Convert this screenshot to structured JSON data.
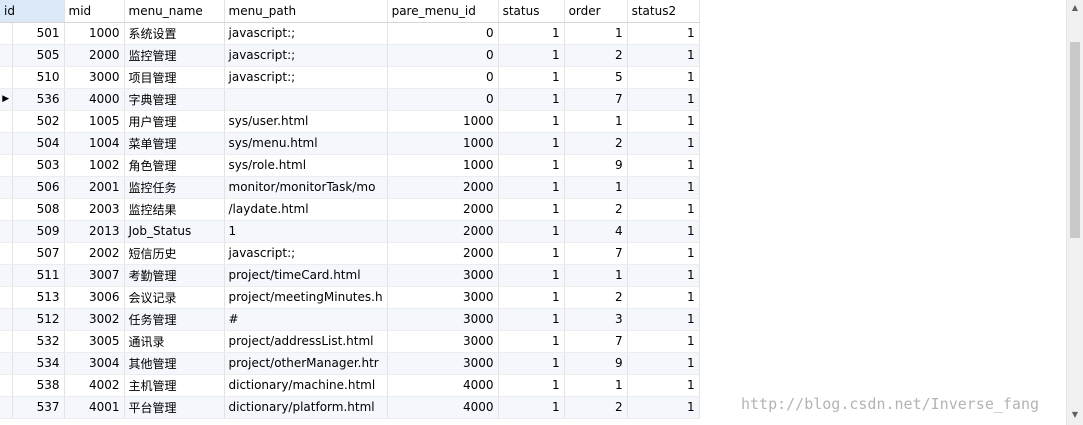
{
  "columns": [
    "id",
    "mid",
    "menu_name",
    "menu_path",
    "pare_menu_id",
    "status",
    "order",
    "status2"
  ],
  "current_row_marker_icon": "triangle-right-icon",
  "rows": [
    {
      "id": "501",
      "mid": "1000",
      "menu_name": "系统设置",
      "menu_path": "javascript:;",
      "pare_menu_id": "0",
      "status": "1",
      "order": "1",
      "status2": "1"
    },
    {
      "id": "505",
      "mid": "2000",
      "menu_name": "监控管理",
      "menu_path": "javascript:;",
      "pare_menu_id": "0",
      "status": "1",
      "order": "2",
      "status2": "1"
    },
    {
      "id": "510",
      "mid": "3000",
      "menu_name": "项目管理",
      "menu_path": "javascript:;",
      "pare_menu_id": "0",
      "status": "1",
      "order": "5",
      "status2": "1"
    },
    {
      "id": "536",
      "mid": "4000",
      "menu_name": "字典管理",
      "menu_path": "",
      "pare_menu_id": "0",
      "status": "1",
      "order": "7",
      "status2": "1"
    },
    {
      "id": "502",
      "mid": "1005",
      "menu_name": "用户管理",
      "menu_path": "sys/user.html",
      "pare_menu_id": "1000",
      "status": "1",
      "order": "1",
      "status2": "1"
    },
    {
      "id": "504",
      "mid": "1004",
      "menu_name": "菜单管理",
      "menu_path": "sys/menu.html",
      "pare_menu_id": "1000",
      "status": "1",
      "order": "2",
      "status2": "1"
    },
    {
      "id": "503",
      "mid": "1002",
      "menu_name": "角色管理",
      "menu_path": "sys/role.html",
      "pare_menu_id": "1000",
      "status": "1",
      "order": "9",
      "status2": "1"
    },
    {
      "id": "506",
      "mid": "2001",
      "menu_name": "监控任务",
      "menu_path": "monitor/monitorTask/mo",
      "pare_menu_id": "2000",
      "status": "1",
      "order": "1",
      "status2": "1"
    },
    {
      "id": "508",
      "mid": "2003",
      "menu_name": "监控结果",
      "menu_path": "/laydate.html",
      "pare_menu_id": "2000",
      "status": "1",
      "order": "2",
      "status2": "1"
    },
    {
      "id": "509",
      "mid": "2013",
      "menu_name": "Job_Status",
      "menu_path": "1",
      "pare_menu_id": "2000",
      "status": "1",
      "order": "4",
      "status2": "1"
    },
    {
      "id": "507",
      "mid": "2002",
      "menu_name": "短信历史",
      "menu_path": "javascript:;",
      "pare_menu_id": "2000",
      "status": "1",
      "order": "7",
      "status2": "1"
    },
    {
      "id": "511",
      "mid": "3007",
      "menu_name": "考勤管理",
      "menu_path": "project/timeCard.html",
      "pare_menu_id": "3000",
      "status": "1",
      "order": "1",
      "status2": "1"
    },
    {
      "id": "513",
      "mid": "3006",
      "menu_name": "会议记录",
      "menu_path": "project/meetingMinutes.h",
      "pare_menu_id": "3000",
      "status": "1",
      "order": "2",
      "status2": "1"
    },
    {
      "id": "512",
      "mid": "3002",
      "menu_name": "任务管理",
      "menu_path": "#",
      "pare_menu_id": "3000",
      "status": "1",
      "order": "3",
      "status2": "1"
    },
    {
      "id": "532",
      "mid": "3005",
      "menu_name": "通讯录",
      "menu_path": "project/addressList.html",
      "pare_menu_id": "3000",
      "status": "1",
      "order": "7",
      "status2": "1"
    },
    {
      "id": "534",
      "mid": "3004",
      "menu_name": "其他管理",
      "menu_path": "project/otherManager.htr",
      "pare_menu_id": "3000",
      "status": "1",
      "order": "9",
      "status2": "1"
    },
    {
      "id": "538",
      "mid": "4002",
      "menu_name": "主机管理",
      "menu_path": "dictionary/machine.html",
      "pare_menu_id": "4000",
      "status": "1",
      "order": "1",
      "status2": "1"
    },
    {
      "id": "537",
      "mid": "4001",
      "menu_name": "平台管理",
      "menu_path": "dictionary/platform.html",
      "pare_menu_id": "4000",
      "status": "1",
      "order": "2",
      "status2": "1"
    }
  ],
  "current_row": 3,
  "scrollbar": {
    "up_icon": "arrow-up-icon",
    "down_icon": "arrow-down-icon"
  },
  "watermark": "http://blog.csdn.net/Inverse_fang"
}
